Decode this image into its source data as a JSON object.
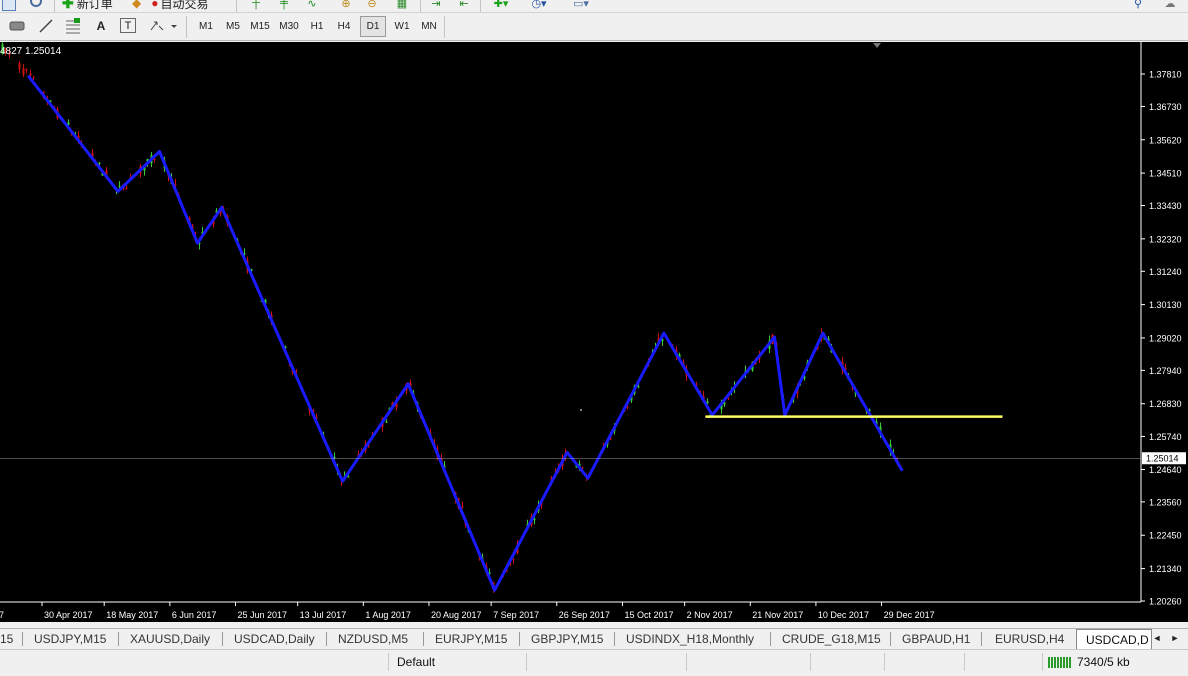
{
  "toolbar_top": {
    "new_order_label": "新订单",
    "autotrading_label": "自动交易"
  },
  "timeframes": [
    "M1",
    "M5",
    "M15",
    "M30",
    "H1",
    "H4",
    "D1",
    "W1",
    "MN"
  ],
  "active_timeframe": "D1",
  "drawing_tools": {
    "text_label": "A",
    "text_label_tool": "T"
  },
  "chart_data": {
    "type": "line",
    "symbol_info": "4827 1.25014",
    "current_price": "1.25014",
    "y_ticks": [
      "1.37810",
      "1.36730",
      "1.35620",
      "1.34510",
      "1.33430",
      "1.32320",
      "1.31240",
      "1.30130",
      "1.29020",
      "1.27940",
      "1.26830",
      "1.25740",
      "1.24640",
      "1.23560",
      "1.22450",
      "1.21340",
      "1.20260"
    ],
    "ylim": [
      1.2026,
      1.3781
    ],
    "x_labels": [
      "7",
      "30 Apr 2017",
      "18 May 2017",
      "6 Jun 2017",
      "25 Jun 2017",
      "13 Jul 2017",
      "1 Aug 2017",
      "20 Aug 2017",
      "7 Sep 2017",
      "26 Sep 2017",
      "15 Oct 2017",
      "2 Nov 2017",
      "21 Nov 2017",
      "10 Dec 2017",
      "29 Dec 2017"
    ],
    "zigzag": [
      {
        "x": "26 Apr 2017",
        "y": 1.3775
      },
      {
        "x": "22 May 2017",
        "y": 1.339
      },
      {
        "x": "3 Jun 2017",
        "y": 1.3523
      },
      {
        "x": "14 Jun 2017",
        "y": 1.3218
      },
      {
        "x": "21 Jun 2017",
        "y": 1.3337
      },
      {
        "x": "26 Jul 2017",
        "y": 1.2425
      },
      {
        "x": "14 Aug 2017",
        "y": 1.2749
      },
      {
        "x": "8 Sep 2017",
        "y": 1.2062
      },
      {
        "x": "29 Sep 2017",
        "y": 1.2521
      },
      {
        "x": "5 Oct 2017",
        "y": 1.2435
      },
      {
        "x": "27 Oct 2017",
        "y": 1.2918
      },
      {
        "x": "10 Nov 2017",
        "y": 1.2645
      },
      {
        "x": "28 Nov 2017",
        "y": 1.2905
      },
      {
        "x": "1 Dec 2017",
        "y": 1.2645
      },
      {
        "x": "12 Dec 2017",
        "y": 1.2918
      },
      {
        "x": "4 Jan 2018",
        "y": 1.246
      }
    ],
    "support_line": {
      "y": 1.264,
      "x_start": "8 Nov 2017",
      "x_end": "2 Feb 2018",
      "color": "#ffff66"
    },
    "colors": {
      "bull": "#33cc33",
      "bear": "#cc1111",
      "zigzag": "#1a1aff",
      "grid": "#444",
      "background": "#000000",
      "axis_text": "#ffffff"
    }
  },
  "chart_tabs": [
    "15",
    "USDJPY,M15",
    "XAUUSD,Daily",
    "USDCAD,Daily",
    "NZDUSD,M5",
    "EURJPY,M15",
    "GBPJPY,M15",
    "USDINDX_H18,Monthly",
    "CRUDE_G18,M15",
    "GBPAUD,H1",
    "EURUSD,H4",
    "USDCAD,D"
  ],
  "active_tab": "USDCAD,D",
  "status": {
    "profile": "Default",
    "traffic": "7340/5 kb"
  }
}
